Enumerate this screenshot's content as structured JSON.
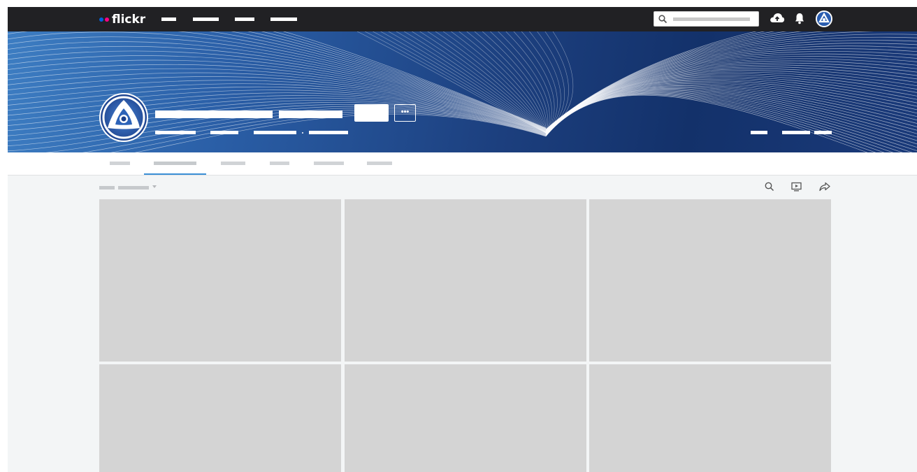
{
  "logo": {
    "text": "flickr"
  },
  "icons": {
    "search": "search-icon",
    "upload": "upload-cloud-icon",
    "notifications": "bell-icon",
    "slideshow": "slideshow-icon",
    "share": "share-icon",
    "more": "more-dots-icon"
  },
  "profile": {
    "more_label": "•••"
  },
  "colors": {
    "nav_bg": "#212124",
    "banner_start": "#3d7dc2",
    "banner_end": "#13316a",
    "active_tab": "#3b8fd6",
    "tile_placeholder": "#d4d4d4",
    "content_bg": "#f3f5f6"
  }
}
